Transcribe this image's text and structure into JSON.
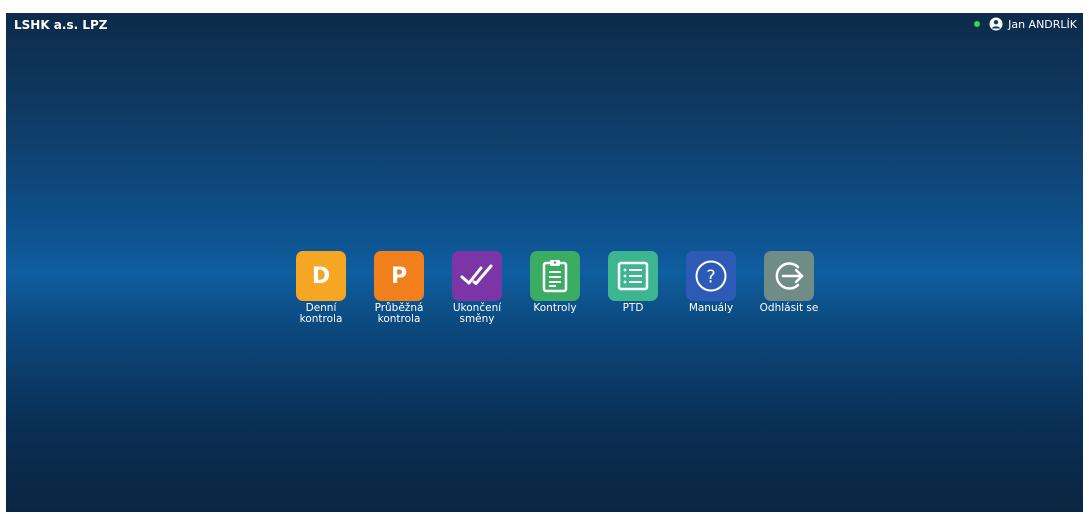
{
  "header": {
    "app_title": "LSHK a.s. LPZ",
    "user_name": "Jan ANDRLÍK",
    "status_color": "#3bd64a"
  },
  "menu": {
    "tiles": [
      {
        "id": "denni",
        "icon": "letter-d-icon",
        "letter": "D",
        "label": "Denní kontrola",
        "color": "#f5a623"
      },
      {
        "id": "prubezna",
        "icon": "letter-p-icon",
        "letter": "P",
        "label": "Průběžná kontrola",
        "color": "#f07f1c"
      },
      {
        "id": "ukonceni",
        "icon": "double-check-icon",
        "label": "Ukončení směny",
        "color": "#7b35a7"
      },
      {
        "id": "kontroly",
        "icon": "clipboard-icon",
        "label": "Kontroly",
        "color": "#3aac63"
      },
      {
        "id": "ptd",
        "icon": "list-icon",
        "label": "PTD",
        "color": "#3db58f"
      },
      {
        "id": "manualy",
        "icon": "question-icon",
        "label": "Manuály",
        "color": "#2d5ab6"
      },
      {
        "id": "odhlasit",
        "icon": "logout-icon",
        "label": "Odhlásit se",
        "color": "#6f8d86"
      }
    ]
  }
}
